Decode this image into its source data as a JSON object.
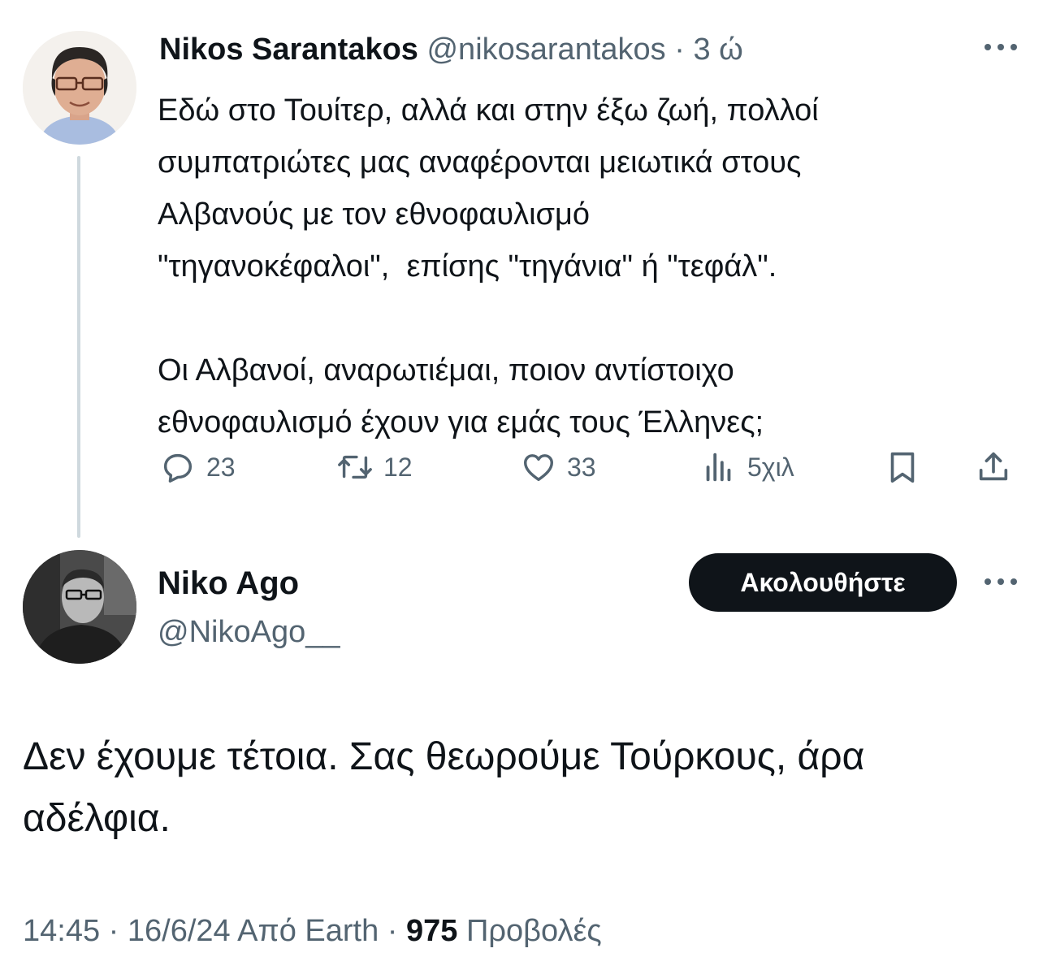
{
  "tweet1": {
    "author_name": "Nikos Sarantakos",
    "handle": "@nikosarantakos",
    "separator": "·",
    "time": "3 ώ",
    "text": "Εδώ στο Τουίτερ, αλλά και στην έξω ζωή, πολλοί\nσυμπατριώτες μας αναφέρονται μειωτικά στους\nΑλβανούς με τον εθνοφαυλισμό\n\"τηγανοκέφαλοι\",  επίσης \"τηγάνια\" ή \"τεφάλ\".\n\nΟι Αλβανοί, αναρωτιέμαι, ποιον αντίστοιχο\nεθνοφαυλισμό έχουν για εμάς τους Έλληνες;",
    "actions": {
      "replies": "23",
      "retweets": "12",
      "likes": "33",
      "views": "5χιλ"
    },
    "icons": [
      "more-icon",
      "reply-icon",
      "retweet-icon",
      "like-icon",
      "views-icon",
      "bookmark-icon",
      "share-icon"
    ]
  },
  "tweet2": {
    "author_name": "Niko Ago",
    "handle": "@NikoAgo__",
    "follow_label": "Ακολουθήστε",
    "text": "Δεν έχουμε τέτοια. Σας θεωρούμε Τούρκους, άρα\nαδέλφια.",
    "meta": {
      "time": "14:45",
      "separator": "·",
      "date": "16/6/24",
      "source": "Από Earth",
      "views_count": "975",
      "views_label": "Προβολές"
    }
  },
  "colors": {
    "text": "#0f1419",
    "muted": "#536471",
    "thread_line": "#cfd9de",
    "button_bg": "#0f1419",
    "button_text": "#ffffff"
  }
}
